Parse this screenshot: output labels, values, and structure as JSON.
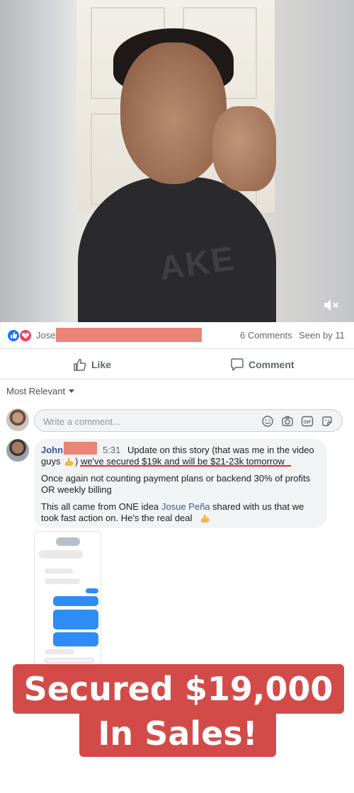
{
  "video": {
    "shirt_text": "AKE",
    "mute_icon": "speaker-muted-icon"
  },
  "reactions": {
    "icons": [
      "like-reaction-icon",
      "love-reaction-icon"
    ],
    "name": "Jose",
    "comments_count": "6 Comments",
    "seen_by": "Seen by 11"
  },
  "actions": {
    "like_label": "Like",
    "comment_label": "Comment"
  },
  "sort": {
    "label": "Most Relevant"
  },
  "comment_input": {
    "placeholder": "Write a comment...",
    "icons": [
      "emoji-icon",
      "camera-icon",
      "gif-icon",
      "sticker-icon"
    ]
  },
  "comment": {
    "author": "John",
    "time": "5:31",
    "line1_a": "Update on this story (that was me in the video",
    "line2_a": "guys",
    "line2_b": ") we've secured $19k and will be $21-23k tomorrow",
    "para2_l1": "Once again not counting payment plans or backend 30% of profits",
    "para2_l2": "OR weekly billing",
    "para3_l1": "This all came from ONE idea",
    "para3_link": "Josue Peña",
    "para3_l1b": "shared with us that we",
    "para3_l2": "took fast action on. He's the real deal"
  },
  "banner": {
    "line1": "Secured $19,000",
    "line2": "In Sales!"
  },
  "colors": {
    "fb_blue": "#385898",
    "banner_red": "#d24b48",
    "redaction": "#e98476",
    "underline_red": "#d4302b"
  }
}
